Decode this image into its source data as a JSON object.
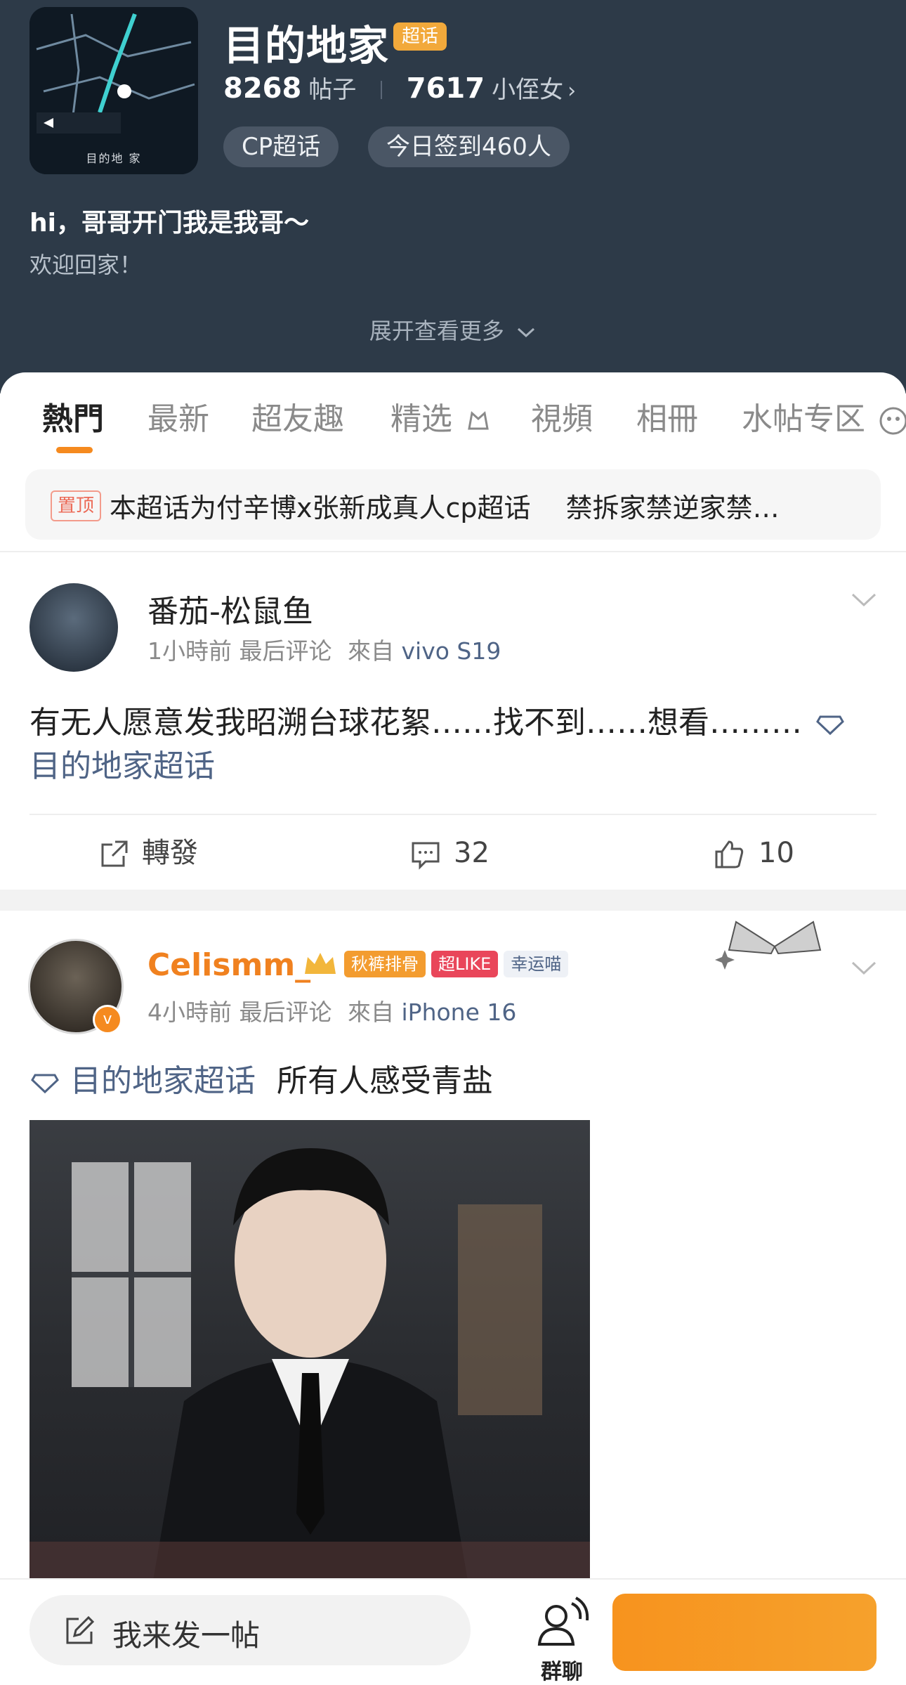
{
  "header": {
    "cover_caption": "目的地 家",
    "title": "目的地家",
    "super_badge": "超话",
    "posts_count": "8268",
    "posts_unit": "帖子",
    "fans_count": "7617",
    "fans_unit": "小侄女",
    "tags": [
      "CP超话",
      "今日签到460人"
    ],
    "description_line1": "hi，哥哥开门我是我哥～",
    "description_line2": "欢迎回家！",
    "expand_label": "展开查看更多"
  },
  "tabs": [
    "熱門",
    "最新",
    "超友趣",
    "精选",
    "視頻",
    "相冊",
    "水帖专区"
  ],
  "pinned": {
    "badge": "置顶",
    "text": "本超话为付辛博x张新成真人cp超话 　禁拆家禁逆家禁…"
  },
  "posts": [
    {
      "username": "番茄-松鼠鱼",
      "time": "1小時前",
      "last_comment": "最后评论",
      "from_label": "來自",
      "device": "vivo S19",
      "text": "有无人愿意发我昭溯台球花絮……找不到……想看………",
      "topic": "目的地家超话",
      "actions": {
        "repost": "轉發",
        "comments": "32",
        "likes": "10"
      }
    },
    {
      "username": "Celismm_",
      "badges": [
        "秋裤排骨",
        "超LIKE",
        "幸运喵"
      ],
      "time": "4小時前",
      "last_comment": "最后评论",
      "from_label": "來自",
      "device": "iPhone 16",
      "topic": "目的地家超话",
      "text": "所有人感受青盐"
    }
  ],
  "bottom_bar": {
    "compose_label": "我来发一帖",
    "group_chat_label": "群聊"
  },
  "colors": {
    "header_bg": "#2d3a48",
    "accent": "#f58a1f",
    "link": "#4f6486",
    "celis_name": "#f0811f"
  }
}
